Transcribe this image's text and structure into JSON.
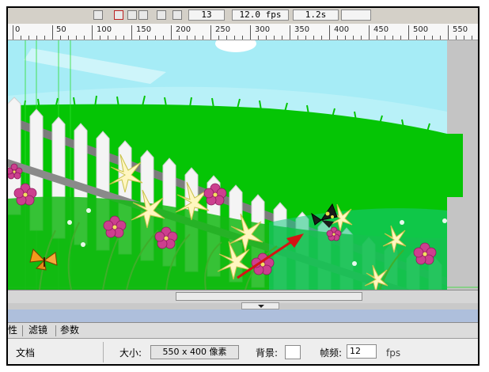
{
  "timeline": {
    "frame_number": "13",
    "frame_rate": "12.0 fps",
    "elapsed_time": "1.2s"
  },
  "ruler": {
    "marks": [
      "0",
      "50",
      "100",
      "150",
      "200",
      "250",
      "300",
      "350",
      "400",
      "450",
      "500",
      "550"
    ]
  },
  "panel": {
    "tabs": [
      {
        "label": "性"
      },
      {
        "label": "滤镜"
      },
      {
        "label": "参数"
      }
    ],
    "document_label": "文档",
    "size_label": "大小:",
    "size_value": "550 x 400 像素",
    "background_label": "背景:",
    "frame_rate_label": "帧频:",
    "frame_rate_value": "12",
    "fps_unit": "fps"
  },
  "colors": {
    "sky": "#b8f1f8",
    "grass": "#00c800",
    "fence": "#f2f2f2",
    "panel_accent": "#aebfdc"
  }
}
